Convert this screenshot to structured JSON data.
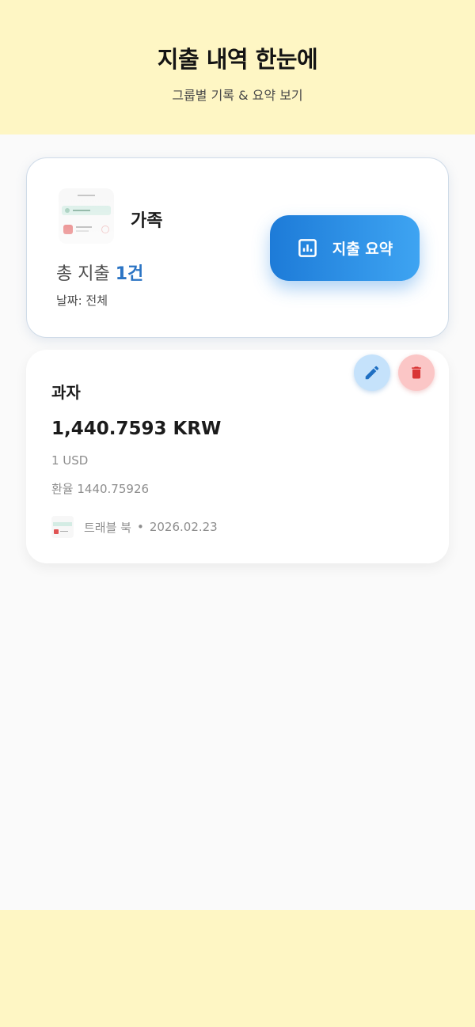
{
  "header": {
    "title": "지출 내역 한눈에",
    "subtitle": "그룹별 기록 & 요약 보기"
  },
  "group": {
    "name": "가족",
    "total_prefix": "총 지출",
    "total_count": "1건",
    "date_filter": "날짜: 전체",
    "summary_button_label": "지출 요약",
    "summary_icon": "bar-chart-icon"
  },
  "expenses": [
    {
      "title": "과자",
      "amount": "1,440.7593 KRW",
      "original_amount": "1 USD",
      "exchange_rate": "환율 1440.75926",
      "book_name": "트래블 북",
      "separator": "•",
      "date": "2026.02.23",
      "edit_icon": "pencil-icon",
      "delete_icon": "trash-icon"
    }
  ],
  "colors": {
    "header_bg": "#fef6c4",
    "accent_blue": "#2b74c4",
    "button_gradient_start": "#1d7bd8",
    "button_gradient_end": "#3ea4f2",
    "edit_bg": "#c5e2fb",
    "delete_bg": "#fbc6c6",
    "delete_icon": "#d93434"
  }
}
